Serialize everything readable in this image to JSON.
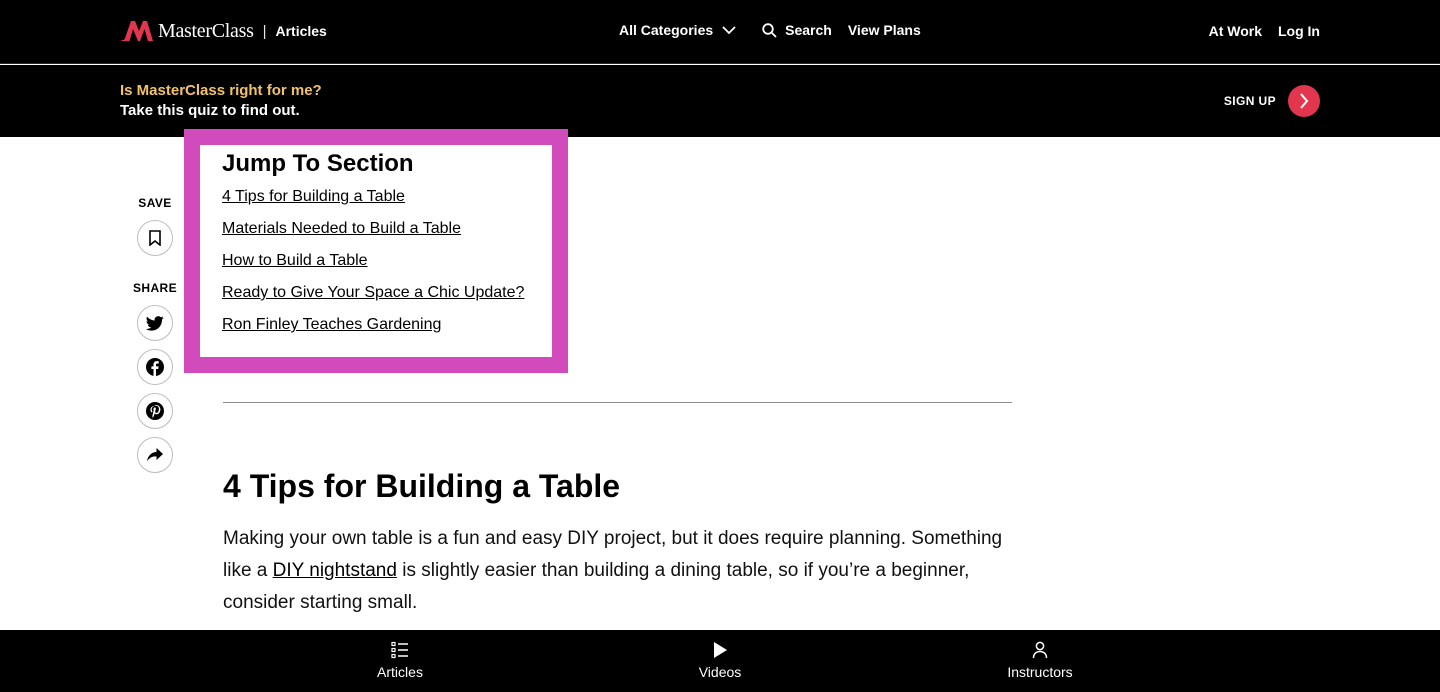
{
  "header": {
    "brand_name": "MasterClass",
    "separator": "|",
    "section": "Articles",
    "nav": {
      "categories": "All Categories",
      "search": "Search",
      "plans": "View Plans"
    },
    "right": {
      "at_work": "At Work",
      "log_in": "Log In"
    }
  },
  "promo": {
    "question": "Is MasterClass right for me?",
    "subtitle": "Take this quiz to find out.",
    "signup": "SIGN UP"
  },
  "rail": {
    "save_label": "SAVE",
    "share_label": "SHARE",
    "icons": [
      "bookmark-icon",
      "twitter-icon",
      "facebook-icon",
      "pinterest-icon",
      "share-arrow-icon"
    ]
  },
  "jump": {
    "title": "Jump To Section",
    "items": [
      "4 Tips for Building a Table",
      "Materials Needed to Build a Table",
      "How to Build a Table",
      "Ready to Give Your Space a Chic Update?",
      "Ron Finley Teaches Gardening"
    ]
  },
  "article": {
    "section_title": "4 Tips for Building a Table",
    "para_before": "Making your own table is a fun and easy DIY project, but it does require planning. Something like a ",
    "para_link": "DIY nightstand",
    "para_after": " is slightly easier than building a dining table, so if you’re a beginner, consider starting small."
  },
  "bottom_tabs": {
    "articles": "Articles",
    "videos": "Videos",
    "instructors": "Instructors"
  },
  "colors": {
    "accent_pink": "#d14bbd",
    "promo_gold": "#f1c26a",
    "signup_red": "#e2364f",
    "logo_red": "#e2364f"
  }
}
